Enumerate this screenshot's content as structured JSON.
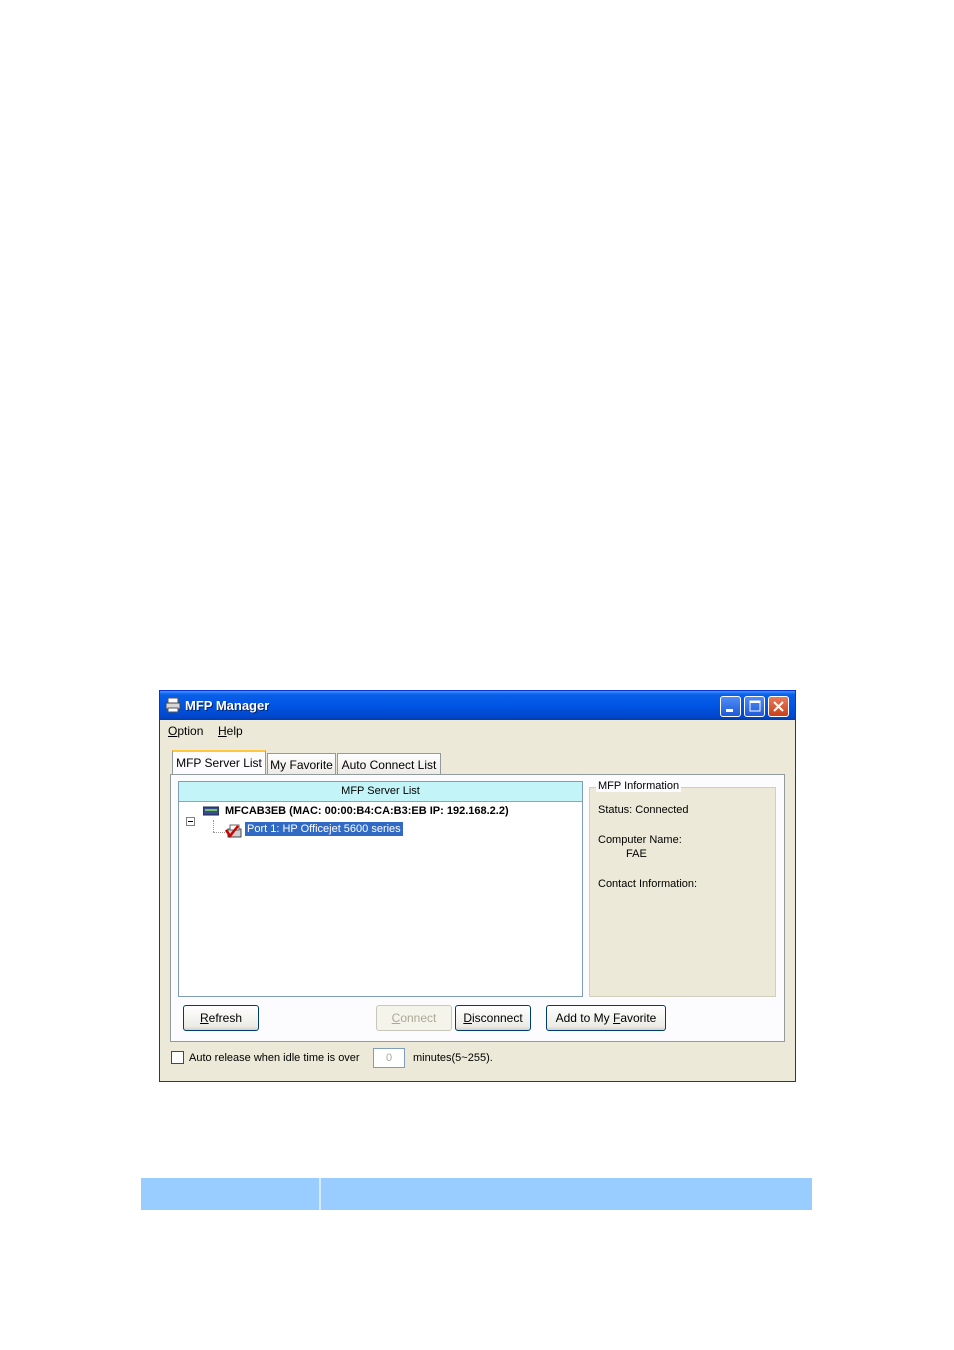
{
  "window": {
    "title": "MFP Manager",
    "title_icon": "printer-icon",
    "controls": [
      "minimize-icon",
      "maximize-icon",
      "close-icon"
    ]
  },
  "menu": {
    "items": [
      {
        "accel": "O",
        "rest": "ption"
      },
      {
        "accel": "H",
        "rest": "elp"
      }
    ]
  },
  "tabs": [
    {
      "label": "MFP Server List",
      "active": true
    },
    {
      "label": "My Favorite",
      "active": false
    },
    {
      "label": "Auto Connect List",
      "active": false
    }
  ],
  "server_list": {
    "header": "MFP Server List",
    "server": {
      "name": "MFCAB3EB (MAC: 00:00:B4:CA:B3:EB   IP: 192.168.2.2)",
      "icon": "server-icon"
    },
    "port": {
      "label": "Port 1: HP Officejet 5600 series",
      "icon": "connected-printer-icon"
    }
  },
  "mfp_info": {
    "legend": "MFP Information",
    "status": "Status: Connected",
    "computer_name_label": "Computer Name:",
    "computer_name_value": "FAE",
    "contact_label": "Contact Information:"
  },
  "buttons": {
    "refresh": {
      "accel": "R",
      "rest": "efresh"
    },
    "connect": {
      "accel": "C",
      "rest": "onnect",
      "disabled": true
    },
    "disconnect": {
      "accel": "D",
      "rest": "isconnect"
    },
    "favorite": {
      "pre": "Add to My ",
      "accel": "F",
      "rest": "avorite"
    }
  },
  "auto_release": {
    "checked": false,
    "label": "Auto release when idle time is over",
    "value": "0",
    "suffix": "minutes(5~255)."
  },
  "colors": {
    "titlebar": "#0055e5",
    "header_cyan": "#c3f5f8",
    "selection": "#316ac5",
    "footer_bar": "#99ccff"
  }
}
